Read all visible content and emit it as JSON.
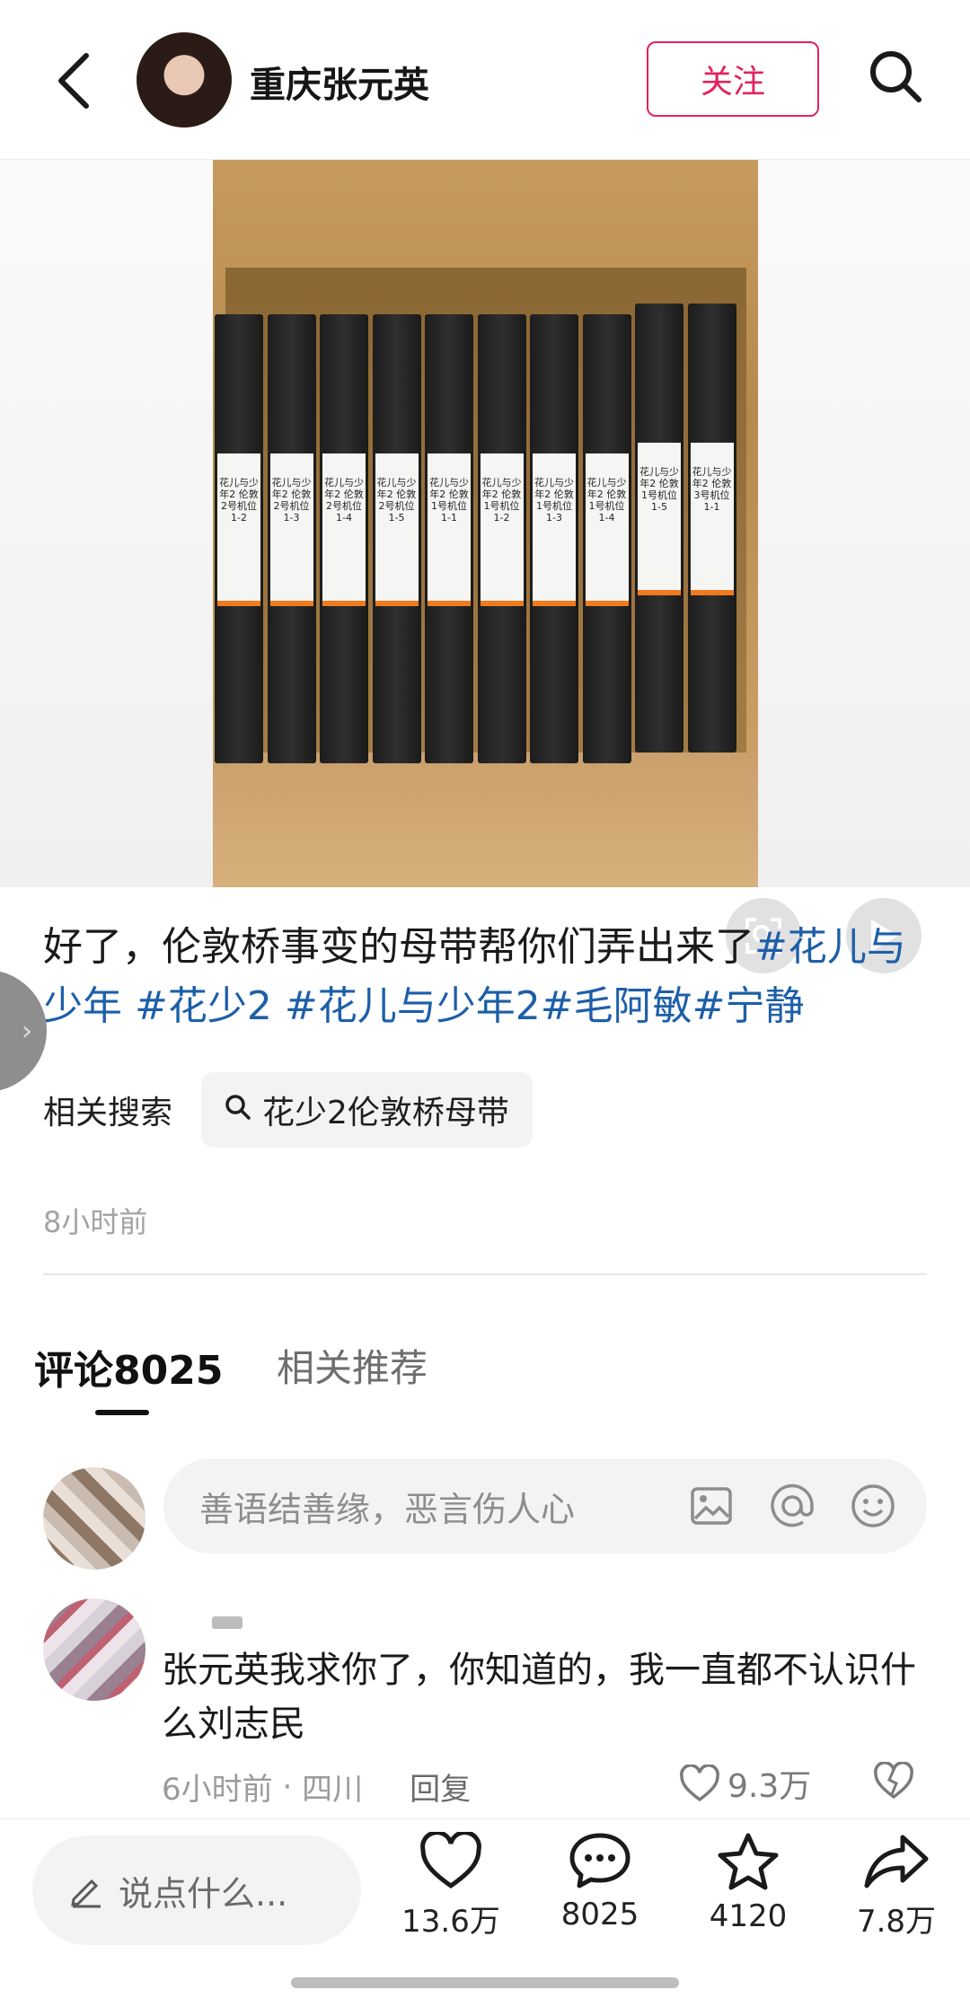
{
  "header": {
    "username": "重庆张元英",
    "follow_label": "关注"
  },
  "media": {
    "tape_labels": [
      "花儿与少年2 伦敦 2号机位 1-2",
      "花儿与少年2 伦敦 2号机位 1-3",
      "花儿与少年2 伦敦 2号机位 1-4",
      "花儿与少年2 伦敦 2号机位 1-5",
      "花儿与少年2 伦敦 1号机位 1-1",
      "花儿与少年2 伦敦 1号机位 1-2",
      "花儿与少年2 伦敦 1号机位 1-3",
      "花儿与少年2 伦敦 1号机位 1-4",
      "花儿与少年2 伦敦 1号机位 1-5",
      "花儿与少年2 伦敦 3号机位 1-1"
    ]
  },
  "post": {
    "text": "好了，伦敦桥事变的母带帮你们弄出来了",
    "tags": [
      "#花儿与少年",
      "#花少2",
      "#花儿与少年2",
      "#毛阿敏",
      "#宁静"
    ],
    "related_label": "相关搜索",
    "related_query": "花少2伦敦桥母带",
    "time": "8小时前"
  },
  "tabs": {
    "comments": "评论8025",
    "related": "相关推荐"
  },
  "comment_input": {
    "placeholder": "善语结善缘，恶言伤人心"
  },
  "comment": {
    "text": "张元英我求你了，你知道的，我一直都不认识什么刘志民",
    "time": "6小时前",
    "location": "四川",
    "reply_label": "回复",
    "likes": "9.3万"
  },
  "bottom_bar": {
    "say_placeholder": "说点什么...",
    "likes": "13.6万",
    "comments": "8025",
    "favorites": "4120",
    "shares": "7.8万"
  },
  "colors": {
    "accent": "#e0245e",
    "tag": "#1d5fa8"
  }
}
